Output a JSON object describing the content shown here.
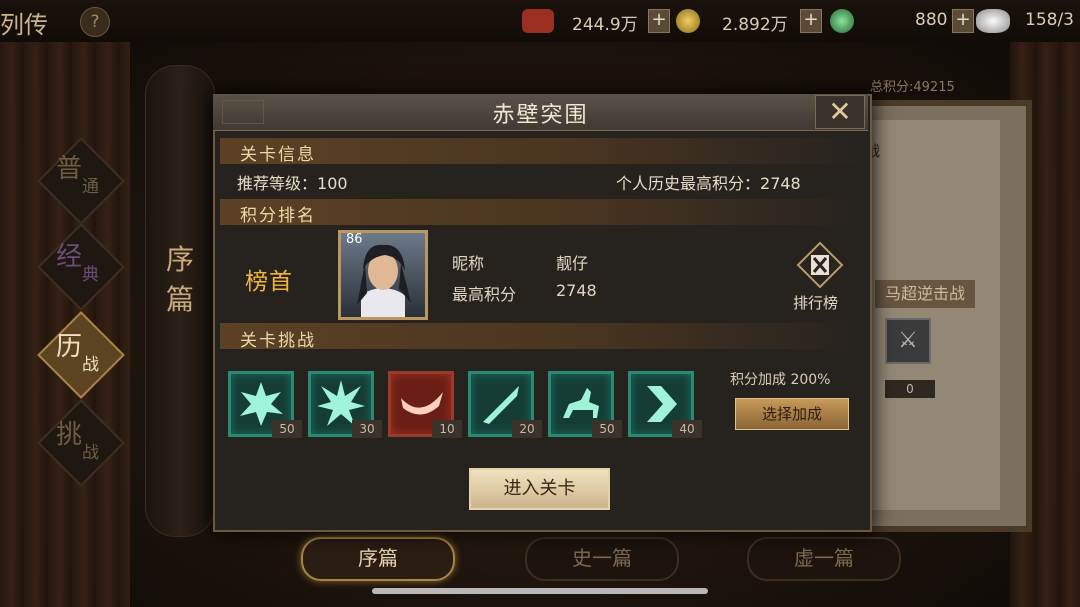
{
  "top_bar": {
    "title": "列传",
    "help_icon": "?",
    "resources": [
      {
        "icon": "coin-stack-icon",
        "value": "244.9万",
        "color": "#b23a2a"
      },
      {
        "icon": "copper-coin-icon",
        "value": "2.892万",
        "color": "#c9a23a"
      },
      {
        "icon": "jade-icon",
        "value": "880",
        "color": "#3aa05a"
      },
      {
        "icon": "silver-ingot-icon",
        "value": "158/3",
        "color": "#cfcfcf"
      }
    ],
    "plus": "+"
  },
  "modes": [
    {
      "big": "普",
      "small": "通"
    },
    {
      "big": "经",
      "small": "典"
    },
    {
      "big": "历",
      "small": "战"
    },
    {
      "big": "挑",
      "small": "战"
    }
  ],
  "scroll_text": "序篇",
  "background_map": {
    "total_score": "总积分:49215",
    "chip": "战",
    "label": "马超逆击战",
    "zero": "0"
  },
  "bottom_tabs": [
    {
      "label": "序篇",
      "active": true
    },
    {
      "label": "史一篇",
      "active": false
    },
    {
      "label": "虚一篇",
      "active": false
    }
  ],
  "dialog": {
    "title": "赤壁突围",
    "close_icon": "✕",
    "level_info": {
      "section": "关卡信息",
      "recommended_label": "推荐等级：",
      "recommended_value": "100",
      "best_score_label": "个人历史最高积分：",
      "best_score_value": "2748"
    },
    "ranking": {
      "section": "积分排名",
      "rank_title": "榜首",
      "player_level": "86",
      "nickname_label": "昵称",
      "nickname_value": "靓仔",
      "top_score_label": "最高积分",
      "top_score_value": "2748",
      "leaderboard_label": "排行榜"
    },
    "challenge": {
      "section": "关卡挑战",
      "items": [
        {
          "icon": "crossed-swords-burst-icon",
          "value": "50",
          "style": "green"
        },
        {
          "icon": "sword-burst-icon",
          "value": "30",
          "style": "green"
        },
        {
          "icon": "horn-icon",
          "value": "10",
          "style": "red"
        },
        {
          "icon": "blade-icon",
          "value": "20",
          "style": "green"
        },
        {
          "icon": "cavalry-icon",
          "value": "50",
          "style": "green"
        },
        {
          "icon": "chevron-right-icon",
          "value": "40",
          "style": "green"
        }
      ],
      "bonus_text": "积分加成 200%",
      "select_bonus_button": "选择加成"
    },
    "enter_button": "进入关卡"
  }
}
